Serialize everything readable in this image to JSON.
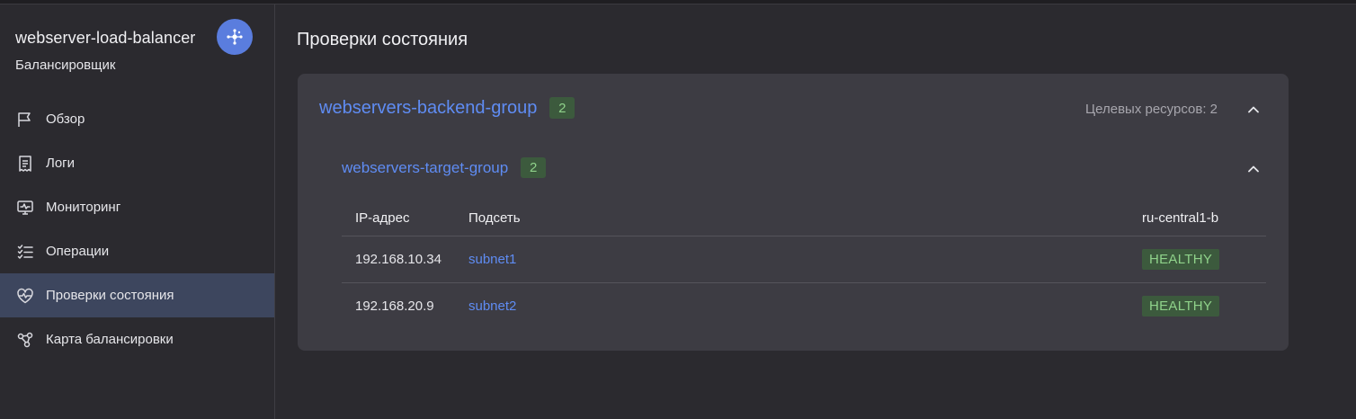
{
  "sidebar": {
    "title": "webserver-load-balancer",
    "subtitle": "Балансировщик",
    "badge_icon": "network-icon",
    "items": [
      {
        "label": "Обзор",
        "icon": "flag-icon",
        "active": false
      },
      {
        "label": "Логи",
        "icon": "receipt-icon",
        "active": false
      },
      {
        "label": "Мониторинг",
        "icon": "monitor-pulse-icon",
        "active": false
      },
      {
        "label": "Операции",
        "icon": "checklist-icon",
        "active": false
      },
      {
        "label": "Проверки состояния",
        "icon": "heart-pulse-icon",
        "active": true
      },
      {
        "label": "Карта балансировки",
        "icon": "nodes-icon",
        "active": false
      }
    ]
  },
  "main": {
    "title": "Проверки состояния",
    "backend_group": {
      "name": "webservers-backend-group",
      "count": "2",
      "targets_label": "Целевых ресурсов: 2",
      "target_group": {
        "name": "webservers-target-group",
        "count": "2",
        "columns": [
          "IP-адрес",
          "Подсеть",
          "ru-central1-b"
        ],
        "rows": [
          {
            "ip": "192.168.10.34",
            "subnet": "subnet1",
            "status": "HEALTHY"
          },
          {
            "ip": "192.168.20.9",
            "subnet": "subnet2",
            "status": "HEALTHY"
          }
        ]
      }
    }
  },
  "colors": {
    "accent": "#5f8cf3",
    "healthy_bg": "#3c5a3d",
    "healthy_text": "#8fd28a",
    "active_nav": "#3d465e"
  }
}
